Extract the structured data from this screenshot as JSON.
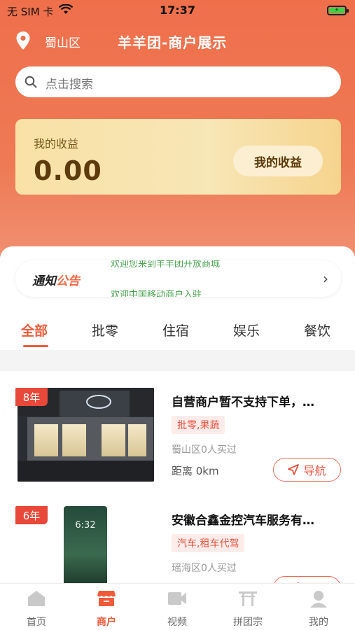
{
  "status_bar": {
    "carrier": "无 SIM 卡",
    "time": "17:37"
  },
  "header": {
    "location": "蜀山区",
    "title": "羊羊团-商户展示"
  },
  "search": {
    "placeholder": "点击搜索"
  },
  "earnings": {
    "label": "我的收益",
    "amount": "0.00",
    "button": "我的收益"
  },
  "notice": {
    "tag_part1": "通知",
    "tag_part2": "公告",
    "line1": "欢迎您来到羊羊团开放商城",
    "line2": "欢迎中国移动商户入驻"
  },
  "tabs": [
    "全部",
    "批零",
    "住宿",
    "娱乐",
    "餐饮"
  ],
  "merchants": [
    {
      "years": "8年",
      "name": "自营商户暂不支持下单，…",
      "category": "批零,果蔬",
      "bought": "蜀山区0人买过",
      "distance": "距离 0km",
      "nav": "导航"
    },
    {
      "years": "6年",
      "name": "安徽合鑫金控汽车服务有…",
      "category": "汽车,租车代驾",
      "bought": "瑶海区0人买过",
      "distance": "",
      "nav": "导航"
    }
  ],
  "phone_time": "6:32",
  "bottom_tabs": [
    {
      "label": "首页",
      "icon": "home-icon"
    },
    {
      "label": "商户",
      "icon": "shop-icon"
    },
    {
      "label": "视频",
      "icon": "video-icon"
    },
    {
      "label": "拼团宗",
      "icon": "gate-icon"
    },
    {
      "label": "我的",
      "icon": "user-icon"
    }
  ],
  "colors": {
    "accent": "#ef5a3a",
    "hero": "#ef6f4b",
    "gold": "#f7e6b6"
  }
}
